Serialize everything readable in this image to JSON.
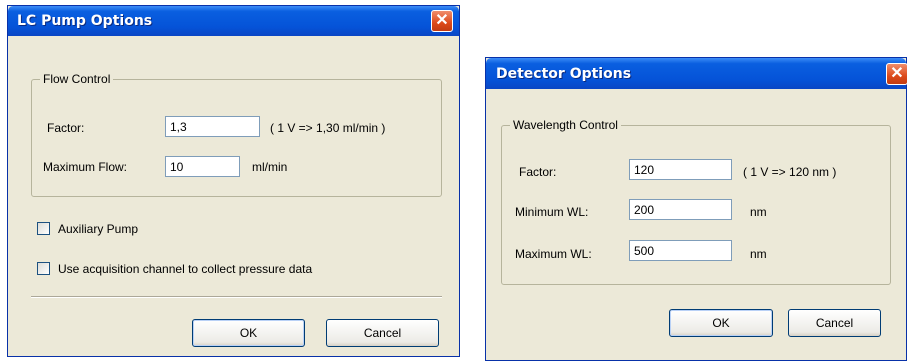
{
  "lc_dialog": {
    "title": "LC Pump Options",
    "close_glyph": "✕",
    "group_title": "Flow Control",
    "factor_label": "Factor:",
    "factor_value": "1,3",
    "factor_hint": "( 1 V => 1,30 ml/min )",
    "max_flow_label": "Maximum Flow:",
    "max_flow_value": "10",
    "max_flow_unit": "ml/min",
    "aux_pump_label": "Auxiliary Pump",
    "aux_pump_checked": false,
    "acq_channel_label": "Use acquisition channel to collect pressure data",
    "acq_channel_checked": false,
    "ok_label": "OK",
    "cancel_label": "Cancel"
  },
  "det_dialog": {
    "title": "Detector Options",
    "close_glyph": "✕",
    "group_title": "Wavelength Control",
    "factor_label": "Factor:",
    "factor_value": "120",
    "factor_hint": "( 1 V => 120 nm )",
    "min_wl_label": "Minimum WL:",
    "min_wl_value": "200",
    "min_wl_unit": "nm",
    "max_wl_label": "Maximum WL:",
    "max_wl_value": "500",
    "max_wl_unit": "nm",
    "ok_label": "OK",
    "cancel_label": "Cancel"
  },
  "colors": {
    "titlebar": "#0553d8",
    "dialog_bg": "#ece9d8",
    "close_button": "#dd4a1a"
  }
}
